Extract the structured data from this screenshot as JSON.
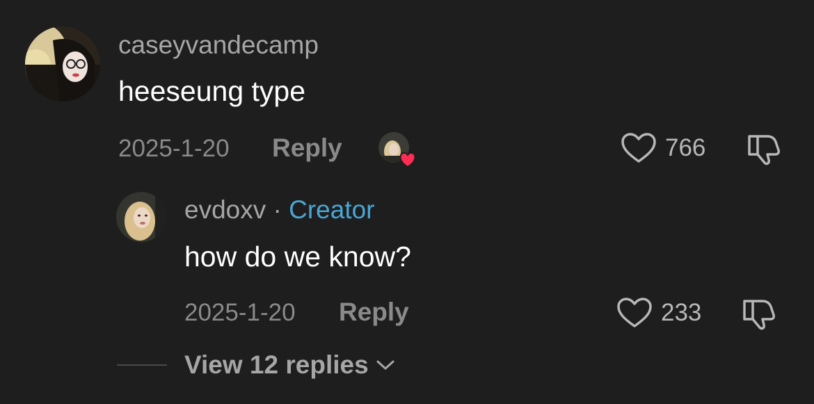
{
  "comment": {
    "username": "caseyvandecamp",
    "text": "heeseung type",
    "date": "2025-1-20",
    "reply_label": "Reply",
    "like_count": "766",
    "liked_by_creator": true
  },
  "reply": {
    "username": "evdoxv",
    "separator": " · ",
    "creator_tag": "Creator",
    "text": "how do we know?",
    "date": "2025-1-20",
    "reply_label": "Reply",
    "like_count": "233"
  },
  "view_replies_label": "View 12 replies",
  "colors": {
    "background": "#1e1e1e",
    "creator_accent": "#4aa6d4",
    "heart_badge": "#fe2c55"
  },
  "icons": {
    "like": "heart-outline-icon",
    "dislike": "thumbs-down-icon",
    "expand": "chevron-down-icon",
    "creator_like": "heart-badge-icon"
  }
}
